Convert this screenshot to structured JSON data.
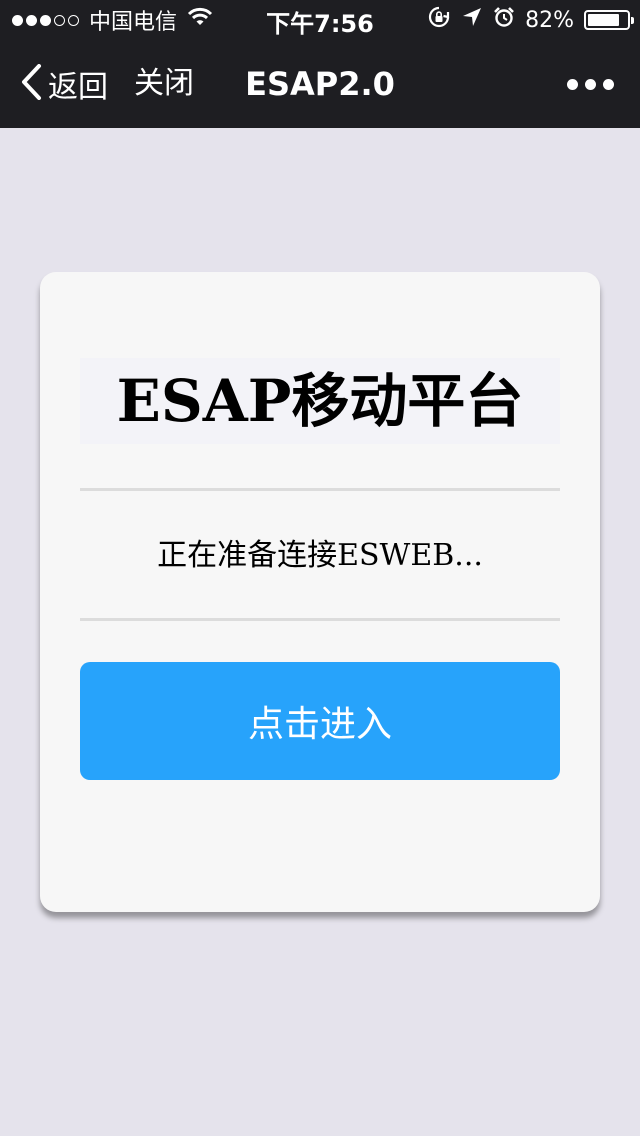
{
  "status_bar": {
    "carrier": "中国电信",
    "time": "下午7:56",
    "battery_percent": "82%",
    "battery_level": 0.82,
    "signal_bars_filled": 3,
    "signal_bars_total": 5,
    "icons": [
      "wifi-icon",
      "rotation-lock-icon",
      "location-arrow-icon",
      "alarm-icon",
      "battery-icon"
    ]
  },
  "navbar": {
    "back_label": "返回",
    "close_label": "关闭",
    "title": "ESAP2.0",
    "more_icon": "more-dots-icon",
    "background": "#1e1e22"
  },
  "card": {
    "title": "ESAP移动平台",
    "status_message": "正在准备连接ESWEB...",
    "enter_button_label": "点击进入",
    "button_color": "#27a3fb"
  },
  "page_background": "#e5e3ec"
}
